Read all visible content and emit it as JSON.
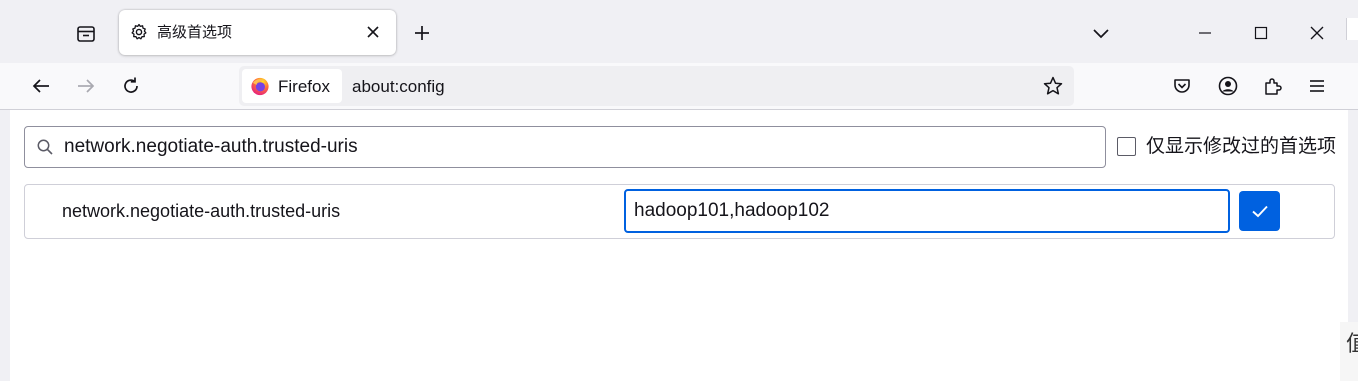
{
  "window": {
    "tab": {
      "title": "高级首选项",
      "icon": "gear-icon"
    },
    "controls": [
      "list-all-tabs-icon",
      "minimize-icon",
      "maximize-icon",
      "close-icon"
    ]
  },
  "navbar": {
    "identity_label": "Firefox",
    "url": "about:config"
  },
  "config": {
    "search_value": "network.negotiate-auth.trusted-uris",
    "show_modified_label": "仅显示修改过的首选项",
    "show_modified_checked": false,
    "pref": {
      "name": "network.negotiate-auth.trusted-uris",
      "value": "hadoop101,hadoop102"
    }
  },
  "background": {
    "edge_glyph": "值"
  },
  "colors": {
    "accent": "#0061e0",
    "chrome": "#f0f0f4",
    "firefox_orange": "#ff7139"
  }
}
